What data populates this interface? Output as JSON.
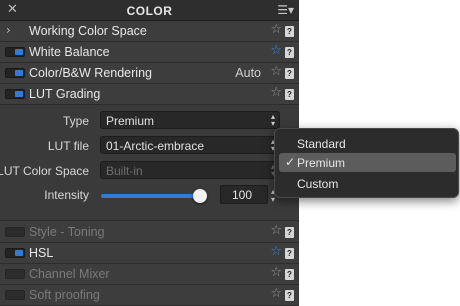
{
  "panel": {
    "title": "COLOR",
    "close_glyph": "✕",
    "menu_glyph": "☰▾"
  },
  "rows": [
    {
      "label": "Working Color Space",
      "kind": "expander"
    },
    {
      "label": "White Balance",
      "kind": "toggle-on",
      "favorite": true
    },
    {
      "label": "Color/B&W Rendering",
      "kind": "toggle-on",
      "value": "Auto"
    },
    {
      "label": "LUT Grading",
      "kind": "toggle-on"
    },
    {
      "label": "Style - Toning",
      "kind": "toggle-off"
    },
    {
      "label": "HSL",
      "kind": "toggle-on",
      "favorite": true
    },
    {
      "label": "Channel Mixer",
      "kind": "toggle-off"
    },
    {
      "label": "Soft proofing",
      "kind": "toggle-off"
    }
  ],
  "lut": {
    "type_label": "Type",
    "type_value": "Premium",
    "file_label": "LUT file",
    "file_value": "01-Arctic-embrace",
    "colorspace_label": "LUT Color Space",
    "colorspace_value": "Built-in",
    "intensity_label": "Intensity",
    "intensity_value": "100",
    "intensity_fraction": 1.0
  },
  "popup": {
    "items": [
      "Standard",
      "Premium",
      "Custom"
    ],
    "selected_index": 1,
    "check_glyph": "✓"
  },
  "glyphs": {
    "star": "☆",
    "help": "?",
    "chevron": "›",
    "updown": "▴▾"
  },
  "colors": {
    "accent": "#2f7bd6",
    "favorite": "#3e8de6"
  }
}
